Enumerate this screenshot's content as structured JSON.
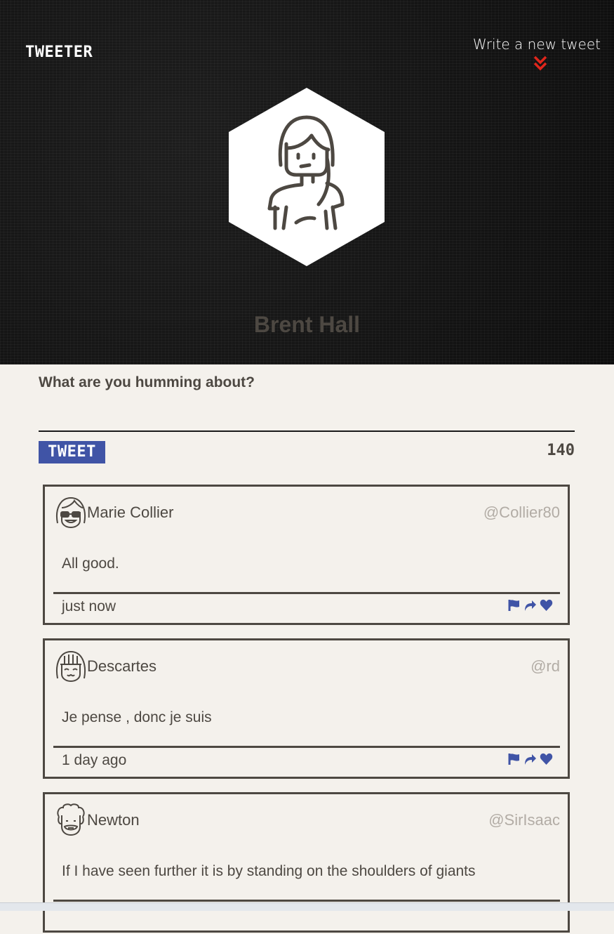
{
  "header": {
    "brand": "TWEETER",
    "compose_link": "Write a new tweet",
    "user_name": "Brent Hall",
    "chevron_icon": "double-chevron-down-icon",
    "chevron_color": "#e0261c"
  },
  "composer": {
    "placeholder": "What are you humming about?",
    "tweet_button": "TWEET",
    "char_count": "140",
    "button_color": "#4054a6"
  },
  "tweets": [
    {
      "name": "Marie Collier",
      "handle": "@Collier80",
      "text": "All good.",
      "time": "just now",
      "avatar": "woman-with-glasses-avatar"
    },
    {
      "name": "Descartes",
      "handle": "@rd",
      "text": "Je pense , donc je suis",
      "time": "1 day ago",
      "avatar": "smiling-girl-avatar"
    },
    {
      "name": "Newton",
      "handle": "@SirIsaac",
      "text": "If I have seen further it is by standing on the shoulders of giants",
      "time": "",
      "avatar": "curly-hair-man-avatar"
    }
  ],
  "actions": [
    "flag-icon",
    "retweet-icon",
    "heart-icon"
  ],
  "colors": {
    "accent": "#4054a6",
    "text": "#4d4842",
    "handle": "#b2aca5",
    "background": "#f4f1ec"
  }
}
